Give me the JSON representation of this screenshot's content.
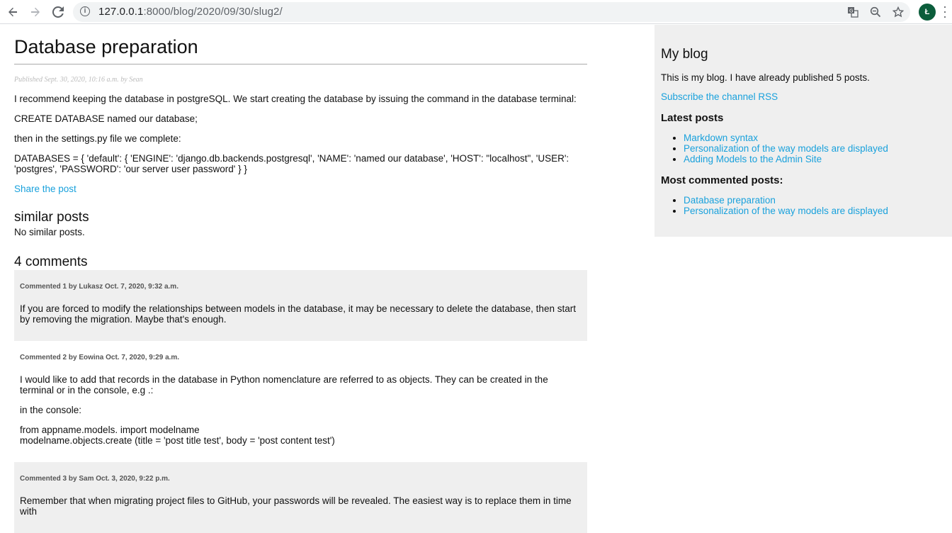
{
  "browser": {
    "url_host": "127.0.0.1",
    "url_rest": ":8000/blog/2020/09/30/slug2/",
    "avatar_letter": "Ł"
  },
  "post": {
    "title": "Database preparation",
    "published": "Published Sept. 30, 2020, 10:16 a.m. by Sean",
    "paragraphs": [
      "I recommend keeping the database in postgreSQL. We start creating the database by issuing the command in the database terminal:",
      "CREATE DATABASE named our database;",
      "then in the settings.py file we complete:",
      "DATABASES = { 'default': { 'ENGINE': 'django.db.backends.postgresql', 'NAME': 'named our database', 'HOST': \"localhost\", 'USER': 'postgres', 'PASSWORD': 'our server user password' } }"
    ],
    "share_label": "Share the post"
  },
  "similar": {
    "title": "similar posts",
    "empty": "No similar posts."
  },
  "comments": {
    "title": "4 comments",
    "items": [
      {
        "info": "Commented 1 by Lukasz Oct. 7, 2020, 9:32 a.m.",
        "lines": [
          "If you are forced to modify the relationships between models in the database, it may be necessary to delete the database, then start by removing the migration. Maybe that's enough."
        ]
      },
      {
        "info": "Commented 2 by Eowina Oct. 7, 2020, 9:29 a.m.",
        "lines": [
          "I would like to add that records in the database in Python nomenclature are referred to as objects. They can be created in the terminal or in the console, e.g .:",
          "in the console:",
          "from appname.models. import modelname",
          "modelname.objects.create (title = 'post title test', body = 'post content test')"
        ]
      },
      {
        "info": "Commented 3 by Sam Oct. 3, 2020, 9:22 p.m.",
        "lines": [
          "Remember that when migrating project files to GitHub, your passwords will be revealed. The easiest way is to replace them in time with"
        ]
      }
    ]
  },
  "sidebar": {
    "title": "My blog",
    "intro": "This is my blog. I have already published 5 posts.",
    "rss_label": "Subscribe the channel RSS",
    "latest_title": "Latest posts",
    "latest": [
      "Markdown syntax",
      "Personalization of the way models are displayed",
      "Adding Models to the Admin Site"
    ],
    "commented_title": "Most commented posts:",
    "commented": [
      "Database preparation",
      "Personalization of the way models are displayed"
    ]
  },
  "colors": {
    "link": "#19a1dc",
    "sidebar_bg": "#efefef",
    "avatar_bg": "#0b5d3b"
  }
}
